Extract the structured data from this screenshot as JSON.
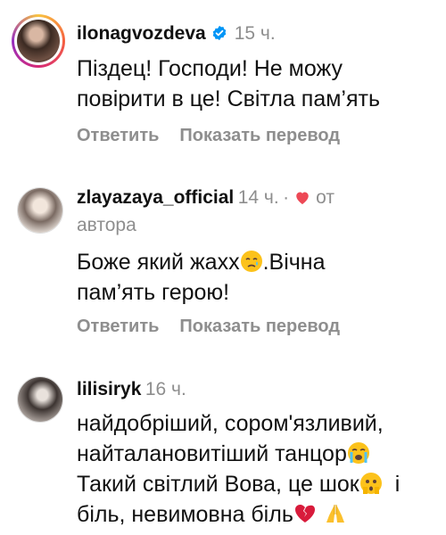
{
  "comments": [
    {
      "username": "ilonagvozdeva",
      "time": "15 ч.",
      "text_lines": [
        "Піздец! Господи! Не можу",
        "повірити в це! Світла пам’ять"
      ],
      "reply_label": "Ответить",
      "translate_label": "Показать перевод",
      "verified": true
    },
    {
      "username": "zlayazaya_official",
      "time": "14 ч.",
      "separator": "·",
      "liked_by_author_label": "от",
      "liked_by_author_label2": "автора",
      "text_line1": "Боже який жахх",
      "text_line1b": ".Вічна",
      "text_line2": "пам’ять герою!",
      "reply_label": "Ответить",
      "translate_label": "Показать перевод",
      "emoji": [
        "crying-face"
      ]
    },
    {
      "username": "lilisiryk",
      "time": "16 ч.",
      "text_line1": "найдобріший, сором'язливий,",
      "text_line2": "найталановитіший танцор",
      "text_line3": "Такий світлий Вова, це шок",
      "text_line3b": "і",
      "text_line4": "біль, невимовна біль",
      "emoji": [
        "loudly-crying-face",
        "face-holding-back-tears",
        "broken-heart",
        "folded-hands"
      ]
    }
  ],
  "colors": {
    "verified_blue": "#0095f6",
    "heart_red": "#ed4956",
    "meta_gray": "#8e8e8e"
  }
}
